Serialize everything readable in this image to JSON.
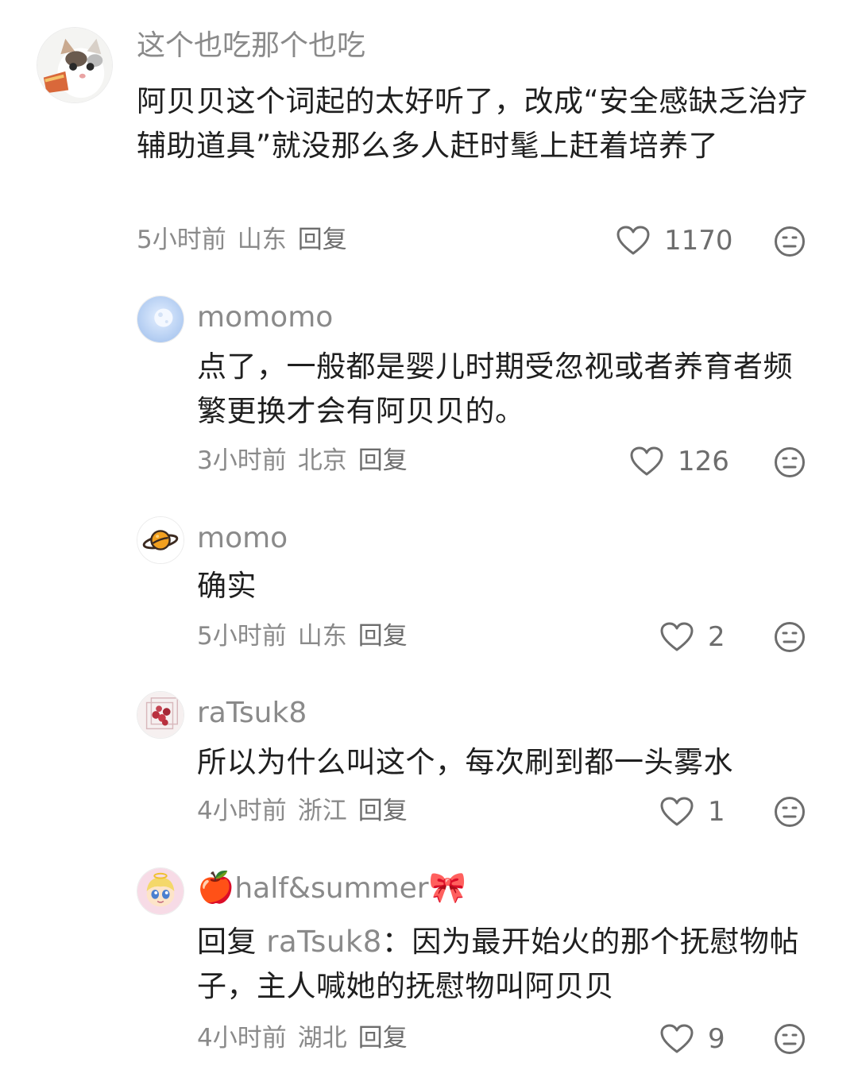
{
  "comments": [
    {
      "username": "这个也吃那个也吃",
      "avatar_icon": "cat-eating-avatar",
      "body": "阿贝贝这个词起的太好听了，改成“安全感缺乏治疗辅助道具”就没那么多人赶时髦上赶着培养了",
      "time": "5小时前",
      "location": "山东",
      "reply_label": "回复",
      "likes": "1170"
    },
    {
      "username": "momomo",
      "avatar_icon": "moon-avatar",
      "body": "点了，一般都是婴儿时期受忽视或者养育者频繁更换才会有阿贝贝的。",
      "time": "3小时前",
      "location": "北京",
      "reply_label": "回复",
      "likes": "126"
    },
    {
      "username": "momo",
      "avatar_icon": "planet-avatar",
      "body": "确实",
      "time": "5小时前",
      "location": "山东",
      "reply_label": "回复",
      "likes": "2"
    },
    {
      "username": "raTsuk8",
      "avatar_icon": "cherry-box-avatar",
      "body": "所以为什么叫这个，每次刷到都一头雾水",
      "time": "4小时前",
      "location": "浙江",
      "reply_label": "回复",
      "likes": "1"
    },
    {
      "username_prefix_emoji": "🍎",
      "username": "half&summer",
      "username_suffix_emoji": "🎀",
      "avatar_icon": "cartoon-girl-avatar",
      "reply_prefix": "回复",
      "reply_to": "raTsuk8",
      "body": "：因为最开始火的那个抚慰物帖子，主人喊她的抚慰物叫阿贝贝",
      "time": "4小时前",
      "location": "湖北",
      "reply_label": "回复",
      "likes": "9"
    }
  ],
  "colors": {
    "text_primary": "#1f1f1f",
    "text_secondary": "#8a8a8a",
    "icon": "#6d6d6d",
    "background": "#ffffff"
  }
}
